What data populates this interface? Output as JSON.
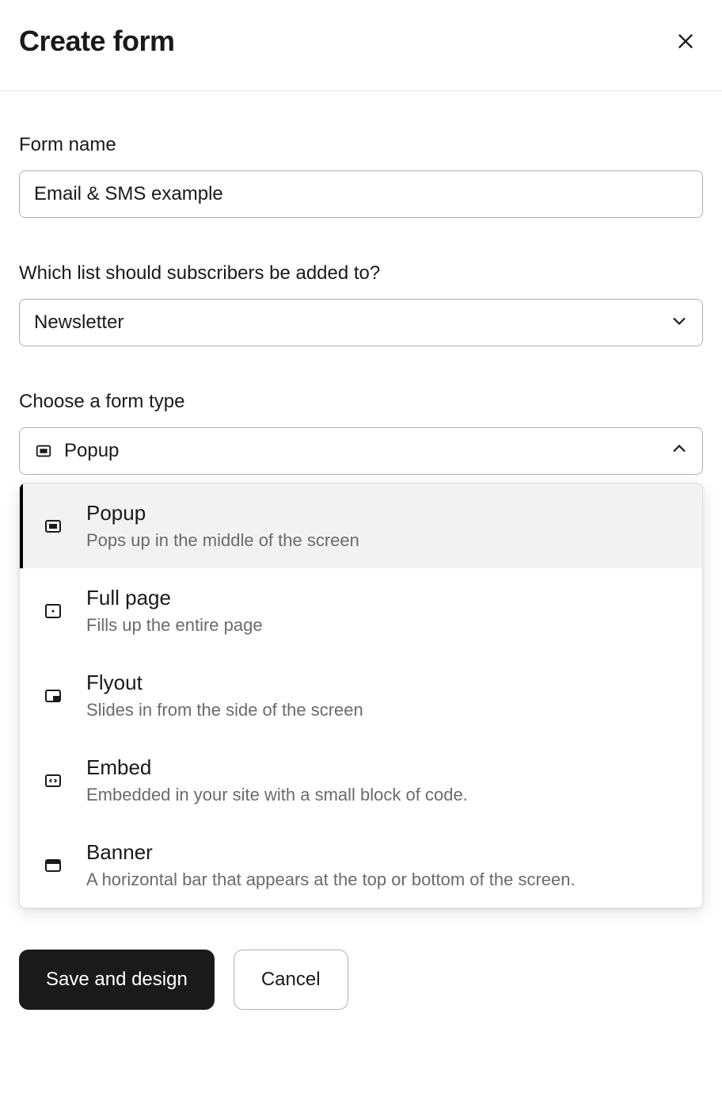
{
  "header": {
    "title": "Create form"
  },
  "form_name": {
    "label": "Form name",
    "value": "Email & SMS example"
  },
  "list": {
    "label": "Which list should subscribers be added to?",
    "value": "Newsletter"
  },
  "form_type": {
    "label": "Choose a form type",
    "value": "Popup",
    "options": [
      {
        "title": "Popup",
        "desc": "Pops up in the middle of the screen"
      },
      {
        "title": "Full page",
        "desc": "Fills up the entire page"
      },
      {
        "title": "Flyout",
        "desc": "Slides in from the side of the screen"
      },
      {
        "title": "Embed",
        "desc": "Embedded in your site with a small block of code."
      },
      {
        "title": "Banner",
        "desc": "A horizontal bar that appears at the top or bottom of the screen."
      }
    ]
  },
  "footer": {
    "primary": "Save and design",
    "secondary": "Cancel"
  }
}
